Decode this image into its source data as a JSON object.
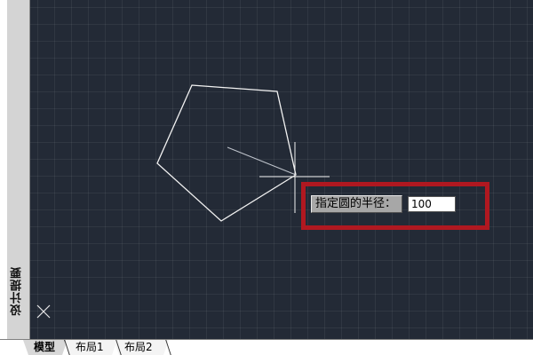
{
  "palette": {
    "label": "设计提要"
  },
  "prompt": {
    "label": "指定圆的半径：",
    "value": "100"
  },
  "tabs": [
    {
      "label": "模型"
    },
    {
      "label": "布局1"
    },
    {
      "label": "布局2"
    }
  ],
  "colors": {
    "canvas_background": "#232a36",
    "drawing_lines": "#f2f2f2",
    "highlight_box": "#b01820"
  },
  "icons": {
    "cursor": "crosshair-icon",
    "ucs": "ucs-icon"
  }
}
